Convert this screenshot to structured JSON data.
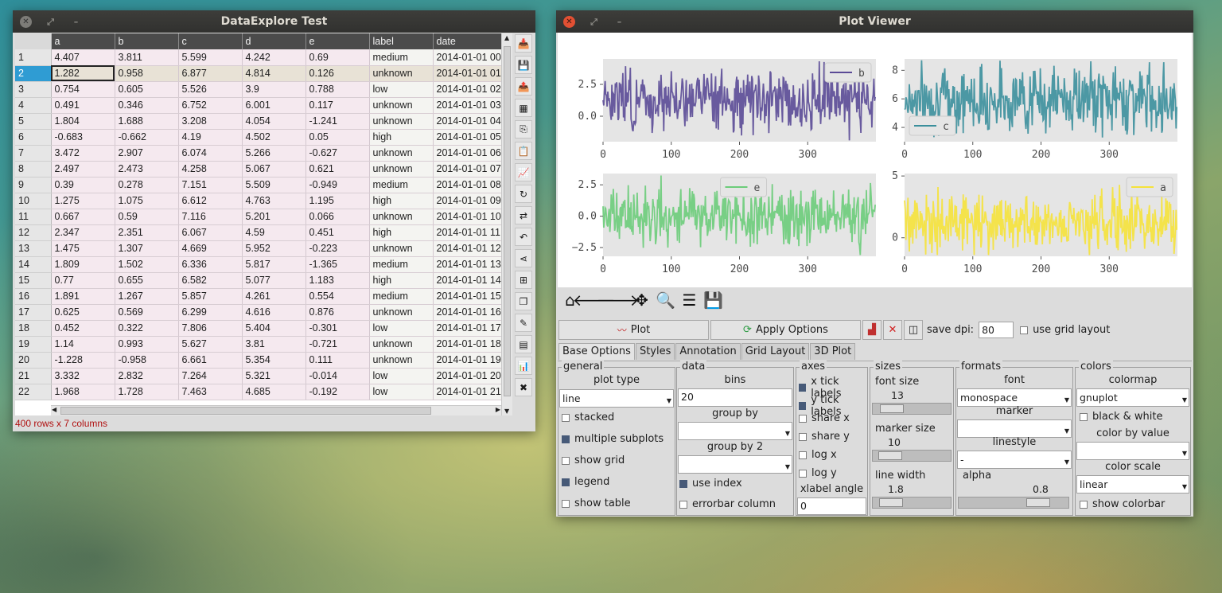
{
  "win1": {
    "title": "DataExplore Test",
    "status": "400 rows x 7 columns",
    "columns": [
      "a",
      "b",
      "c",
      "d",
      "e",
      "label",
      "date"
    ],
    "rows": [
      [
        "1",
        "4.407",
        "3.811",
        "5.599",
        "4.242",
        "0.69",
        "medium",
        "2014-01-01 00"
      ],
      [
        "2",
        "1.282",
        "0.958",
        "6.877",
        "4.814",
        "0.126",
        "unknown",
        "2014-01-01 01"
      ],
      [
        "3",
        "0.754",
        "0.605",
        "5.526",
        "3.9",
        "0.788",
        "low",
        "2014-01-01 02"
      ],
      [
        "4",
        "0.491",
        "0.346",
        "6.752",
        "6.001",
        "0.117",
        "unknown",
        "2014-01-01 03"
      ],
      [
        "5",
        "1.804",
        "1.688",
        "3.208",
        "4.054",
        "-1.241",
        "unknown",
        "2014-01-01 04"
      ],
      [
        "6",
        "-0.683",
        "-0.662",
        "4.19",
        "4.502",
        "0.05",
        "high",
        "2014-01-01 05"
      ],
      [
        "7",
        "3.472",
        "2.907",
        "6.074",
        "5.266",
        "-0.627",
        "unknown",
        "2014-01-01 06"
      ],
      [
        "8",
        "2.497",
        "2.473",
        "4.258",
        "5.067",
        "0.621",
        "unknown",
        "2014-01-01 07"
      ],
      [
        "9",
        "0.39",
        "0.278",
        "7.151",
        "5.509",
        "-0.949",
        "medium",
        "2014-01-01 08"
      ],
      [
        "10",
        "1.275",
        "1.075",
        "6.612",
        "4.763",
        "1.195",
        "high",
        "2014-01-01 09"
      ],
      [
        "11",
        "0.667",
        "0.59",
        "7.116",
        "5.201",
        "0.066",
        "unknown",
        "2014-01-01 10"
      ],
      [
        "12",
        "2.347",
        "2.351",
        "6.067",
        "4.59",
        "0.451",
        "high",
        "2014-01-01 11"
      ],
      [
        "13",
        "1.475",
        "1.307",
        "4.669",
        "5.952",
        "-0.223",
        "unknown",
        "2014-01-01 12"
      ],
      [
        "14",
        "1.809",
        "1.502",
        "6.336",
        "5.817",
        "-1.365",
        "medium",
        "2014-01-01 13"
      ],
      [
        "15",
        "0.77",
        "0.655",
        "6.582",
        "5.077",
        "1.183",
        "high",
        "2014-01-01 14"
      ],
      [
        "16",
        "1.891",
        "1.267",
        "5.857",
        "4.261",
        "0.554",
        "medium",
        "2014-01-01 15"
      ],
      [
        "17",
        "0.625",
        "0.569",
        "6.299",
        "4.616",
        "0.876",
        "unknown",
        "2014-01-01 16"
      ],
      [
        "18",
        "0.452",
        "0.322",
        "7.806",
        "5.404",
        "-0.301",
        "low",
        "2014-01-01 17"
      ],
      [
        "19",
        "1.14",
        "0.993",
        "5.627",
        "3.81",
        "-0.721",
        "unknown",
        "2014-01-01 18"
      ],
      [
        "20",
        "-1.228",
        "-0.958",
        "6.661",
        "5.354",
        "0.111",
        "unknown",
        "2014-01-01 19"
      ],
      [
        "21",
        "3.332",
        "2.832",
        "7.264",
        "5.321",
        "-0.014",
        "low",
        "2014-01-01 20"
      ],
      [
        "22",
        "1.968",
        "1.728",
        "7.463",
        "4.685",
        "-0.192",
        "low",
        "2014-01-01 21"
      ]
    ]
  },
  "win2": {
    "title": "Plot Viewer",
    "plot_button": "Plot",
    "apply_button": "Apply Options",
    "save_dpi_label": "save dpi:",
    "save_dpi_value": "80",
    "grid_layout_label": "use grid layout",
    "tabs": [
      "Base Options",
      "Styles",
      "Annotation",
      "Grid Layout",
      "3D Plot"
    ],
    "general": {
      "title": "general",
      "plot_type_label": "plot type",
      "plot_type_value": "line",
      "stacked": "stacked",
      "multiple_subplots": "multiple subplots",
      "show_grid": "show grid",
      "legend": "legend",
      "show_table": "show table"
    },
    "data": {
      "title": "data",
      "bins_label": "bins",
      "bins_value": "20",
      "group_by": "group by",
      "group_by_2": "group by 2",
      "use_index": "use index",
      "errorbar_column": "errorbar column"
    },
    "axes": {
      "title": "axes",
      "x_tick_labels": "x tick labels",
      "y_tick_labels": "y tick labels",
      "share_x": "share x",
      "share_y": "share y",
      "log_x": "log x",
      "log_y": "log y",
      "xlabel_angle": "xlabel angle",
      "xlabel_angle_value": "0"
    },
    "sizes": {
      "title": "sizes",
      "font_size": "font size",
      "font_size_value": "13",
      "marker_size": "marker size",
      "marker_size_value": "10",
      "line_width": "line width",
      "line_width_value": "1.8"
    },
    "formats": {
      "title": "formats",
      "font": "font",
      "font_value": "monospace",
      "marker": "marker",
      "linestyle": "linestyle",
      "linestyle_value": "-",
      "alpha": "alpha",
      "alpha_value": "0.8"
    },
    "colors": {
      "title": "colors",
      "colormap": "colormap",
      "colormap_value": "gnuplot",
      "black_white": "black & white",
      "color_by_value": "color by value",
      "color_scale": "color scale",
      "color_scale_value": "linear",
      "show_colorbar": "show colorbar"
    }
  },
  "slider_levels": {
    "font_size": 0.13,
    "marker_size": 0.1,
    "line_width": 0.12,
    "alpha": 0.8
  },
  "chart_data": [
    {
      "type": "line",
      "series": [
        {
          "name": "b",
          "color": "#5a4a96"
        }
      ],
      "xlim": [
        0,
        400
      ],
      "ylim": [
        -2,
        4.5
      ],
      "xticks": [
        0,
        100,
        200,
        300
      ],
      "yticks": [
        "0.0",
        "2.5"
      ],
      "ytick_values": [
        0,
        2.5
      ],
      "legend": "top-right",
      "grid": false,
      "seed": 3,
      "center": 1.3,
      "spread": 1.6
    },
    {
      "type": "line",
      "series": [
        {
          "name": "c",
          "color": "#3b8f9c"
        }
      ],
      "xlim": [
        0,
        400
      ],
      "ylim": [
        3,
        8.8
      ],
      "xticks": [
        0,
        100,
        200,
        300
      ],
      "yticks": [
        "4",
        "6",
        "8"
      ],
      "ytick_values": [
        4,
        6,
        8
      ],
      "legend": "bottom-left",
      "grid": false,
      "seed": 7,
      "center": 6,
      "spread": 1.6
    },
    {
      "type": "line",
      "series": [
        {
          "name": "e",
          "color": "#6ccc7a"
        }
      ],
      "xlim": [
        0,
        400
      ],
      "ylim": [
        -3.2,
        3.4
      ],
      "xticks": [
        0,
        100,
        200,
        300
      ],
      "yticks": [
        "−2.5",
        "0.0",
        "2.5"
      ],
      "ytick_values": [
        -2.5,
        0,
        2.5
      ],
      "legend": "top-center",
      "grid": false,
      "seed": 11,
      "center": 0,
      "spread": 1.6
    },
    {
      "type": "line",
      "series": [
        {
          "name": "a",
          "color": "#f5e23a"
        }
      ],
      "xlim": [
        0,
        400
      ],
      "ylim": [
        -1.5,
        5.2
      ],
      "xticks": [
        0,
        100,
        200,
        300
      ],
      "yticks": [
        "0",
        "5"
      ],
      "ytick_values": [
        0,
        5
      ],
      "legend": "top-right",
      "grid": false,
      "seed": 19,
      "center": 1.3,
      "spread": 1.7
    }
  ]
}
